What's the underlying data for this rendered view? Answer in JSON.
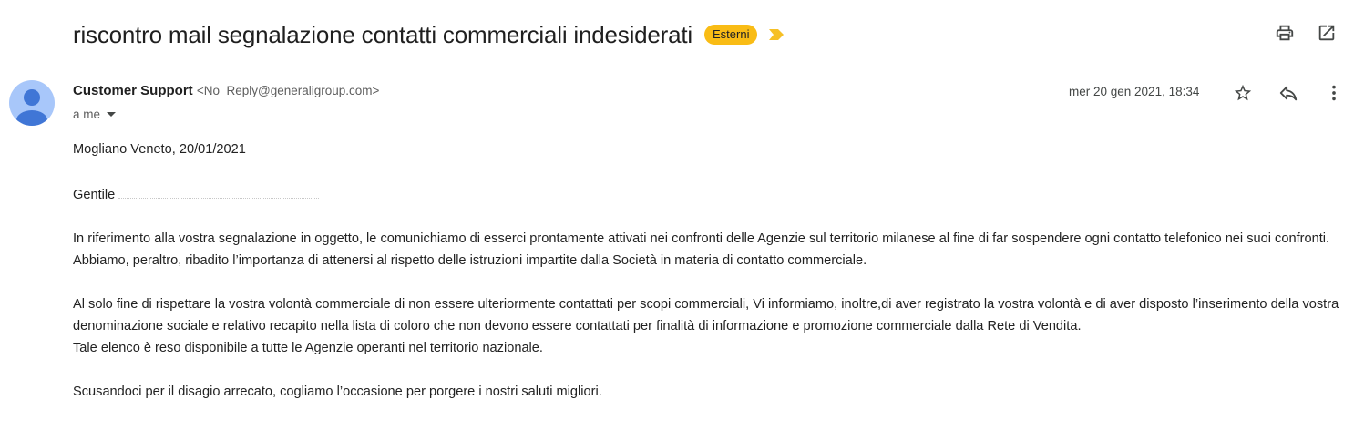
{
  "header": {
    "subject": "riscontro mail segnalazione contatti commerciali indesiderati",
    "label_badge": "Esterni",
    "badge_color": "#f9bc15",
    "importance_color": "#f6c026",
    "icons": [
      "print-icon",
      "open-in-new-window-icon"
    ]
  },
  "message": {
    "sender_name": "Customer Support",
    "sender_email": "<No_Reply@generaligroup.com>",
    "recipient": "a me",
    "date": "mer 20 gen 2021, 18:34",
    "action_icons": [
      "star-icon",
      "reply-icon",
      "more-vert-icon"
    ]
  },
  "body": {
    "place_date": "Mogliano Veneto, 20/01/2021",
    "greeting": "Gentile",
    "p1": "In riferimento alla vostra segnalazione in oggetto, le comunichiamo di esserci prontamente attivati nei confronti delle Agenzie sul territorio milanese al fine di far sospendere ogni contatto telefonico nei suoi confronti. Abbiamo, peraltro, ribadito l’importanza di attenersi al rispetto delle istruzioni impartite dalla Società in materia di contatto commerciale.",
    "p2": "Al solo fine di rispettare la vostra volontà commerciale  di non essere ulteriormente  contattati per scopi commerciali, Vi informiamo, inoltre,di aver registrato la vostra volontà e di aver disposto l’inserimento della vostra denominazione sociale  e relativo recapito nella lista di coloro che non devono essere contattati per finalità di informazione e promozione commerciale dalla Rete di Vendita.",
    "p3": "Tale elenco è reso disponibile a tutte le Agenzie operanti nel territorio nazionale.",
    "p4": "Scusandoci per il disagio arrecato, cogliamo l’occasione per porgere i nostri saluti migliori."
  }
}
